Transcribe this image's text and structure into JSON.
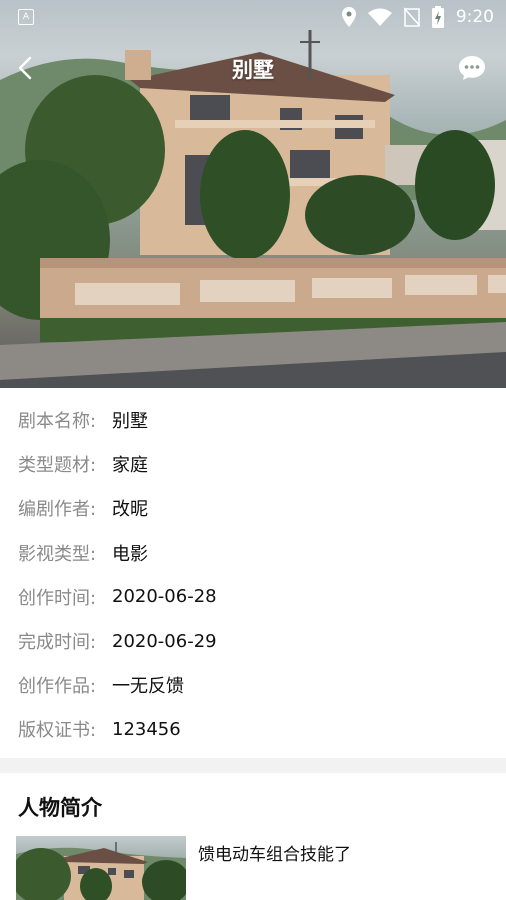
{
  "status_bar": {
    "left_icon": "a-notification-icon",
    "time": "9:20",
    "icons": [
      "location-icon",
      "wifi-icon",
      "no-signal-icon",
      "battery-charging-icon"
    ]
  },
  "header": {
    "title": "别墅",
    "back_icon": "chevron-left-icon",
    "message_icon": "message-bubble-icon"
  },
  "info": {
    "rows": [
      {
        "label": "剧本名称:",
        "value": "别墅"
      },
      {
        "label": "类型题材:",
        "value": "家庭"
      },
      {
        "label": "编剧作者:",
        "value": "改昵"
      },
      {
        "label": "影视类型:",
        "value": "电影"
      },
      {
        "label": "创作时间:",
        "value": "2020-06-28"
      },
      {
        "label": "完成时间:",
        "value": "2020-06-29"
      },
      {
        "label": "创作作品:",
        "value": "一无反馈"
      },
      {
        "label": "版权证书:",
        "value": "123456"
      }
    ]
  },
  "characters": {
    "title": "人物简介",
    "items": [
      {
        "description": "馈电动车组合技能了"
      }
    ]
  },
  "colors": {
    "label": "#8a8a8a",
    "value": "#111111",
    "divider": "#f2f2f2"
  }
}
